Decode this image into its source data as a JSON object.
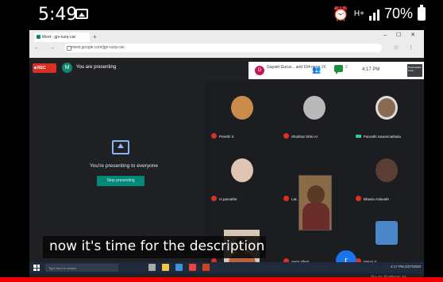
{
  "phone_status": {
    "time": "5:49",
    "battery": "70%",
    "data_indicator": "H+"
  },
  "browser": {
    "tab_title": "Meet - jgv-ruzq-cac",
    "url": "meet.google.com/jgv-ruzq-cac"
  },
  "meet": {
    "rec_label": "REC",
    "user_initial": "M",
    "presenting_label": "You are presenting",
    "guest_initial": "G",
    "guest_names": "Gayatri Gurus... and 154 more",
    "people_count": "26",
    "chat_count": "2",
    "time": "4:17 PM",
    "presentation_chip": "Presentation Prod...",
    "present_message": "You're presenting to everyone",
    "stop_button": "Stop presenting",
    "participants": [
      {
        "name": "Preethi S",
        "muted": true
      },
      {
        "name": "Shobhat Shiki AI",
        "muted": true
      },
      {
        "name": "Parvathi Swaminathaku",
        "muted": false
      },
      {
        "name": "rs parvathe",
        "muted": true
      },
      {
        "name": "Lat...",
        "muted": true
      },
      {
        "name": "Bhavla Avlavath",
        "muted": true
      },
      {
        "name": "",
        "muted": true
      },
      {
        "name": "reeja albert",
        "muted": true
      },
      {
        "name": "Manoj S",
        "muted": true
      }
    ],
    "r_initial": "r"
  },
  "windows": {
    "watermark_line1": "Activate Windows",
    "watermark_line2": "Go to Settings to activate Windows.",
    "search_placeholder": "Type here to search",
    "tray_time": "4:17 PM",
    "tray_date": "2/27/2020"
  },
  "caption": "now it's time for the description",
  "colors": {
    "meet_bg": "#202124",
    "rec_red": "#d93025",
    "stop_teal": "#00897b",
    "progress_red": "#ee0000"
  }
}
